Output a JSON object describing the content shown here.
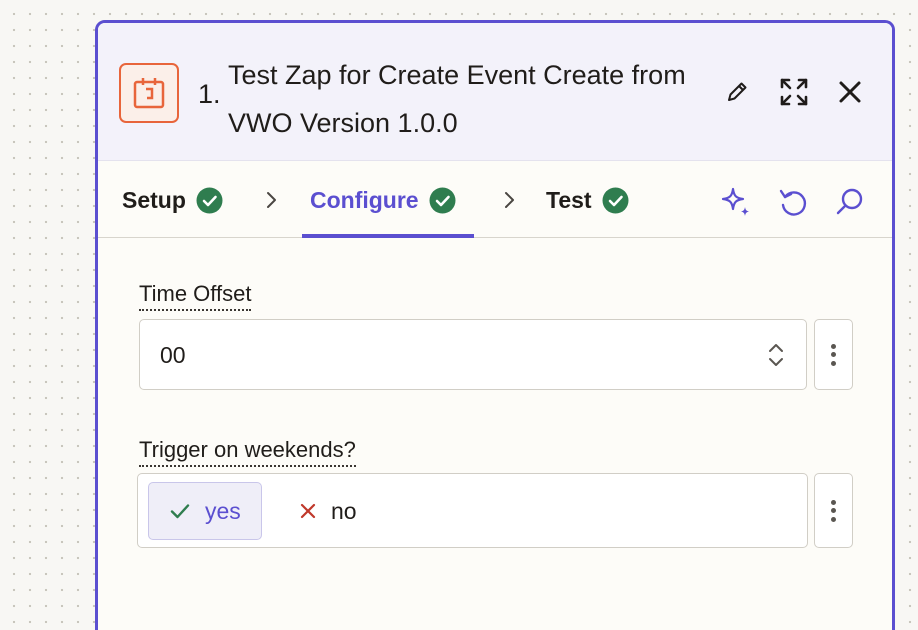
{
  "step": {
    "number": "1.",
    "title": "Test Zap for Create Event Create from VWO Version 1.0.0",
    "app_icon": "calendar-clock-icon"
  },
  "header_actions": [
    {
      "icon": "pencil-icon"
    },
    {
      "icon": "expand-icon"
    },
    {
      "icon": "close-icon"
    }
  ],
  "tabs": [
    {
      "label": "Setup",
      "complete": true
    },
    {
      "label": "Configure",
      "complete": true,
      "active": true
    },
    {
      "label": "Test",
      "complete": true
    }
  ],
  "tools": [
    {
      "icon": "sparkle-icon"
    },
    {
      "icon": "undo-icon"
    },
    {
      "icon": "search-icon"
    }
  ],
  "fields": {
    "time_offset": {
      "label": "Time Offset",
      "value": "00"
    },
    "trigger_weekends": {
      "label": "Trigger on weekends?",
      "options": [
        {
          "label": "yes",
          "selected": true
        },
        {
          "label": "no",
          "selected": false
        }
      ]
    }
  },
  "colors": {
    "accent": "#5b4fd0",
    "success": "#2f7d4f",
    "app_brand": "#e8653b",
    "error": "#c0392b"
  }
}
